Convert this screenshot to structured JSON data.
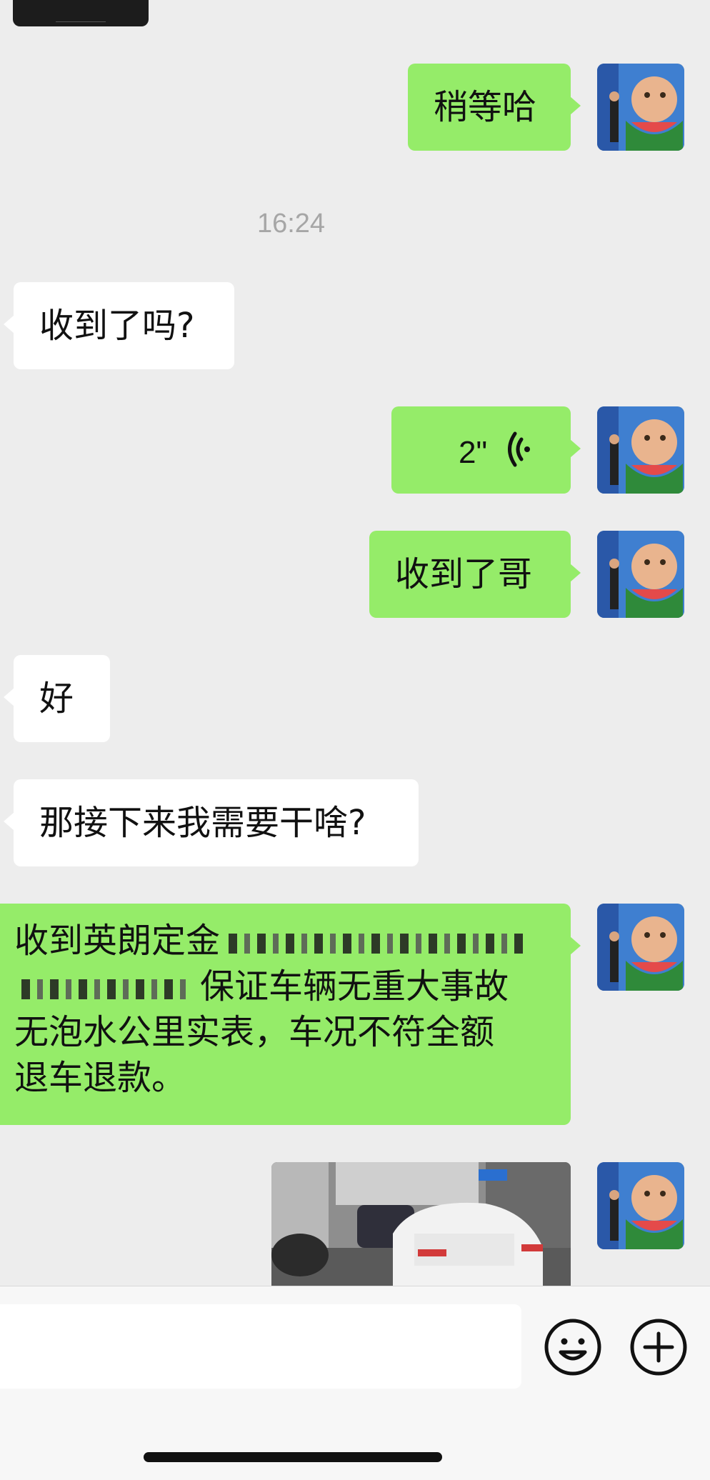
{
  "messages": {
    "m1": "稍等哈",
    "timestamp": "16:24",
    "m2": "收到了吗?",
    "m3_voice_duration": "2\"",
    "m4": "收到了哥",
    "m5": "好",
    "m6": "那接下来我需要干啥?",
    "m7_line1": "收到英朗定金",
    "m7_line2": "保证车辆无重大事故",
    "m7_line3": "无泡水公里实表，车况不符全额",
    "m7_line4": "退车退款。"
  },
  "colors": {
    "outgoing_bubble": "#95ec69",
    "incoming_bubble": "#ffffff",
    "background": "#ededed"
  },
  "icons": {
    "voice": "voice-wave-icon",
    "emoji": "emoji-icon",
    "add": "plus-circle-icon"
  }
}
